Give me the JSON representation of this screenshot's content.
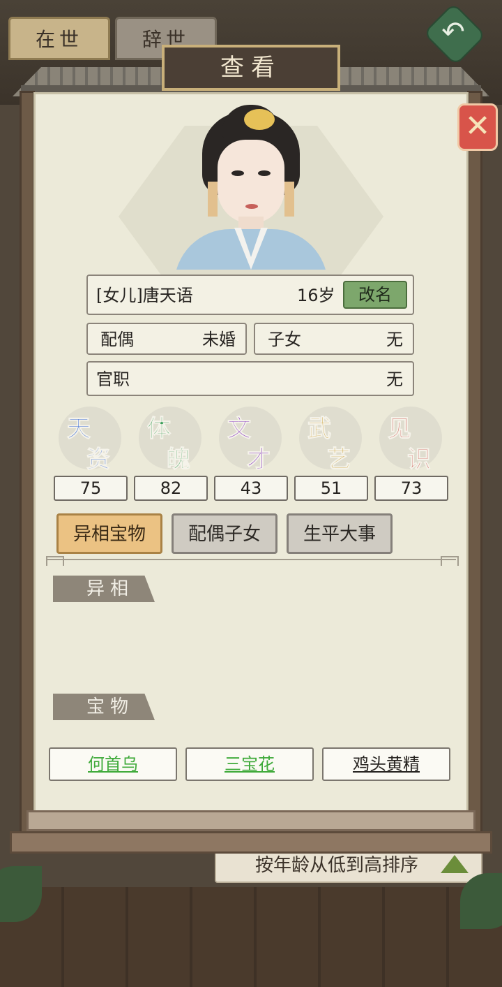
{
  "background": {
    "tabs": [
      "在世",
      "辞世"
    ],
    "sort_label": "按年龄从低到高排序",
    "back_icon": "back-arrow-icon"
  },
  "dialog": {
    "title": "查看",
    "close_icon": "close-icon"
  },
  "profile": {
    "name": "[女儿]唐天语",
    "age": "16岁",
    "rename_label": "改名",
    "spouse_label": "配偶",
    "spouse_value": "未婚",
    "children_label": "子女",
    "children_value": "无",
    "office_label": "官职",
    "office_value": "无"
  },
  "attributes": [
    {
      "label_top": "天",
      "label_bottom": "资",
      "value": "75",
      "color": "#3f6fd6"
    },
    {
      "label_top": "体",
      "label_bottom": "魄",
      "value": "82",
      "color": "#3c9f5a"
    },
    {
      "label_top": "文",
      "label_bottom": "才",
      "value": "43",
      "color": "#8d43c4"
    },
    {
      "label_top": "武",
      "label_bottom": "艺",
      "value": "51",
      "color": "#c89a2c"
    },
    {
      "label_top": "见",
      "label_bottom": "识",
      "value": "73",
      "color": "#d0655f"
    }
  ],
  "tabs": [
    {
      "label": "异相宝物",
      "active": true
    },
    {
      "label": "配偶子女",
      "active": false
    },
    {
      "label": "生平大事",
      "active": false
    }
  ],
  "sections": {
    "traits_title": "异相",
    "treasures_title": "宝物"
  },
  "treasures": [
    {
      "label": "何首乌",
      "color": "#3faa3a"
    },
    {
      "label": "三宝花",
      "color": "#3faa3a"
    },
    {
      "label": "鸡头黄精",
      "color": "#262320"
    }
  ]
}
